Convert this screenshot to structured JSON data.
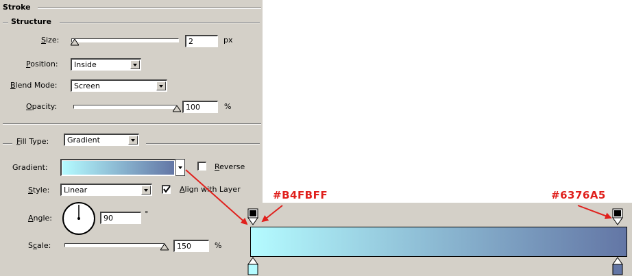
{
  "stroke_panel": {
    "title": "Stroke",
    "structure_title": "Structure",
    "size": {
      "label": "Size:",
      "value": "2",
      "unit": "px",
      "level": 0.0
    },
    "position": {
      "label": "Position:",
      "value": "Inside"
    },
    "blend_mode": {
      "label": "Blend Mode:",
      "value": "Screen"
    },
    "opacity": {
      "label": "Opacity:",
      "value": "100",
      "unit": "%",
      "level": 1.0
    },
    "fill_type": {
      "label": "Fill Type:",
      "value": "Gradient"
    },
    "gradient": {
      "label": "Gradient:",
      "start_color": "#B4FBFF",
      "end_color": "#6376A5"
    },
    "reverse": {
      "label": "Reverse",
      "checked": false
    },
    "style": {
      "label": "Style:",
      "value": "Linear"
    },
    "align_with_layer": {
      "label": "Align with Layer",
      "checked": true
    },
    "angle": {
      "label": "Angle:",
      "value": "90",
      "unit": "°"
    },
    "scale": {
      "label": "Scale:",
      "value": "150",
      "unit": "%",
      "level": 1.0
    }
  },
  "gradient_editor": {
    "start_stop_label": "#B4FBFF",
    "end_stop_label": "#6376A5",
    "start_color": "#B4FBFF",
    "end_color": "#6376A5"
  },
  "colors": {
    "annotation": "#e0201c",
    "panel_bg": "#d4d0c8"
  }
}
